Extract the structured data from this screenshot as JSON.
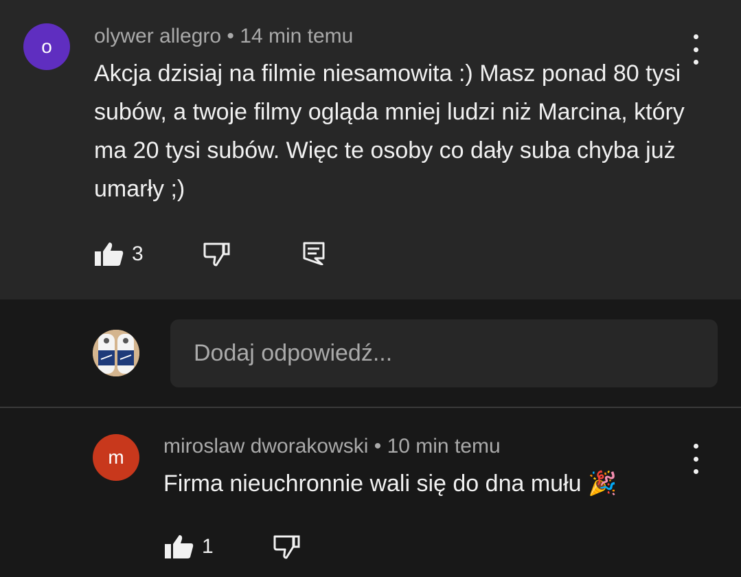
{
  "comment1": {
    "avatar_letter": "o",
    "avatar_color": "#5f2ec0",
    "meta": "olywer allegro • 14 min temu",
    "text": "Akcja dzisiaj na filmie niesamowita :) Masz ponad 80 tysi subów, a twoje filmy ogląda mniej ludzi niż Marcina, który ma 20 tysi subów. Więc te osoby co dały suba chyba już umarły ;)",
    "likes": "3"
  },
  "reply": {
    "placeholder": "Dodaj odpowiedź..."
  },
  "comment2": {
    "avatar_letter": "m",
    "avatar_color": "#c8381c",
    "meta": "miroslaw dworakowski • 10 min temu",
    "text": "Firma nieuchronnie wali się do dna mułu 🎉",
    "likes": "1"
  },
  "icons": {
    "like": "thumbs-up-icon",
    "dislike": "thumbs-down-icon",
    "reply": "comment-reply-icon",
    "menu": "more-vertical-icon"
  }
}
